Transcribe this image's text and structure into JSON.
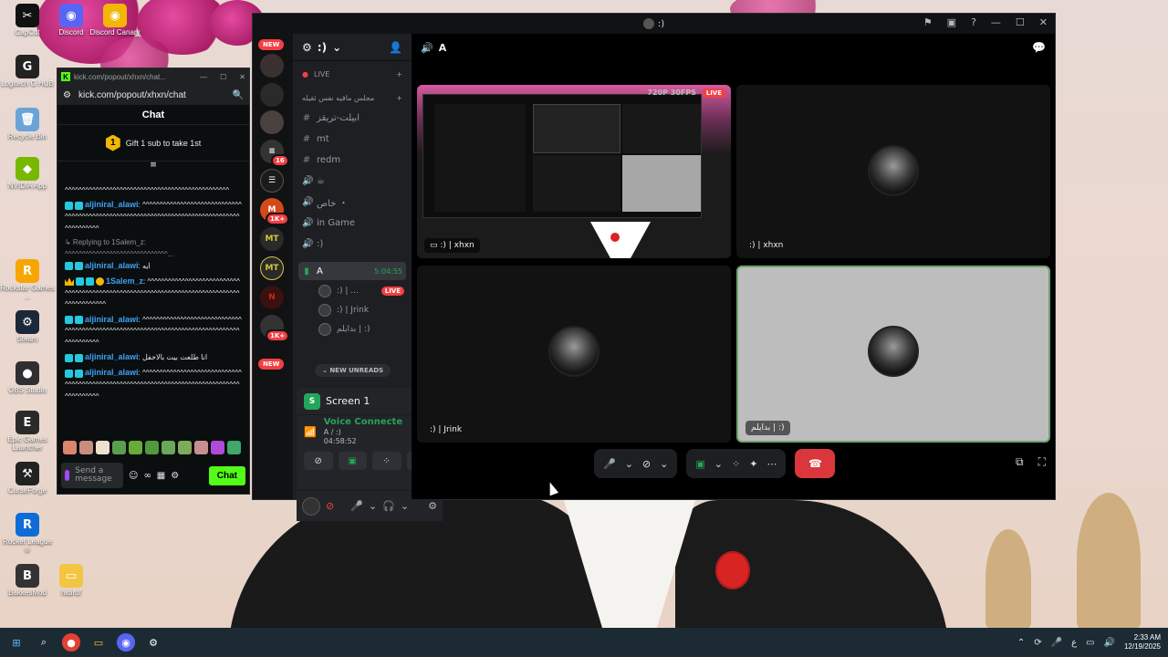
{
  "desktop": {
    "icons": [
      {
        "label": "CapCut",
        "icon": "capcut-icon",
        "color": "#111111",
        "glyph": "✂"
      },
      {
        "label": "Discord",
        "icon": "discord-icon",
        "color": "#5865f2",
        "glyph": "◉"
      },
      {
        "label": "Discord Canary",
        "icon": "discord-canary-icon",
        "color": "#f2b705",
        "glyph": "◉"
      },
      {
        "label": "Logitech G HUB",
        "icon": "logitech-ghub-icon",
        "color": "#222222",
        "glyph": "G"
      },
      {
        "label": "Recycle Bin",
        "icon": "recycle-bin-icon",
        "color": "#6aa3d8",
        "glyph": "🗑"
      },
      {
        "label": "NVIDIA App",
        "icon": "nvidia-icon",
        "color": "#76b900",
        "glyph": "◆"
      },
      {
        "label": "Rockstar Games ...",
        "icon": "rockstar-icon",
        "color": "#f7a600",
        "glyph": "R"
      },
      {
        "label": "Steam",
        "icon": "steam-icon",
        "color": "#1b2838",
        "glyph": "⚙"
      },
      {
        "label": "OBS Studio",
        "icon": "obs-icon",
        "color": "#302e31",
        "glyph": "●"
      },
      {
        "label": "Epic Games Launcher",
        "icon": "epic-games-icon",
        "color": "#2a2a2a",
        "glyph": "E"
      },
      {
        "label": "CurseForge",
        "icon": "curseforge-icon",
        "color": "#222222",
        "glyph": "⚒"
      },
      {
        "label": "Rocket League ®",
        "icon": "rocket-league-icon",
        "color": "#0f6cd6",
        "glyph": "R"
      },
      {
        "label": "BakkesMod",
        "icon": "bakkesmod-icon",
        "color": "#333333",
        "glyph": "B"
      },
      {
        "label": "hidirdf",
        "icon": "folder-icon",
        "color": "#f4c542",
        "glyph": "▭"
      }
    ]
  },
  "kick": {
    "tab_title": "kick.com/popout/xhxn/chat...",
    "url": "kick.com/popout/xhxn/chat",
    "chat_title": "Chat",
    "gift_count": "1",
    "gift_text": "Gift 1 sub to take 1st",
    "messages": [
      {
        "user": "",
        "text": "^^^^^^^^^^^^^^^^^^^^^^^^^^^^^^^^^^^^^^^^^^^^^^^^",
        "reply": ""
      },
      {
        "user": "aljiniral_alawi",
        "text": "^^^^^^^^^^^^^^^^^^^^^^^^^^^^^^^^^^^^^^^^^^^^^^^^^^^^^^^^^^^^^^^^^^^^^^^^^^^^^^^^^^^^^^^^^^",
        "reply": ""
      },
      {
        "user": "aljiniral_alawi",
        "text": "ايه",
        "reply": "Replying to 1Salem_z: ^^^^^^^^^^^^^^^^^^^^^^^^^^^^^^..."
      },
      {
        "user": "1Salem_z",
        "text": "^^^^^^^^^^^^^^^^^^^^^^^^^^^^^^^^^^^^^^^^^^^^^^^^^^^^^^^^^^^^^^^^^^^^^^^^^^^^^^^^^^^^^^^^^^",
        "reply": ""
      },
      {
        "user": "aljiniral_alawi",
        "text": "^^^^^^^^^^^^^^^^^^^^^^^^^^^^^^^^^^^^^^^^^^^^^^^^^^^^^^^^^^^^^^^^^^^^^^^^^^^^^^^^^^^^^^^^^^",
        "reply": ""
      },
      {
        "user": "aljiniral_alawi",
        "text": "انا طلعت بيت بالاخفل",
        "reply": ""
      },
      {
        "user": "aljiniral_alawi",
        "text": "^^^^^^^^^^^^^^^^^^^^^^^^^^^^^^^^^^^^^^^^^^^^^^^^^^^^^^^^^^^^^^^^^^^^^^^^^^^^^^^^^^^^^^^^^^",
        "reply": ""
      }
    ],
    "input_placeholder": "Send a message",
    "chat_button": "Chat"
  },
  "discord": {
    "window_title": ":)",
    "server_name": ":)",
    "new_pill": "NEW",
    "guild_badges": [
      "16",
      "1K+",
      "1K+"
    ],
    "channels": {
      "live_category": "LIVE",
      "category": "مجلس مافيه نفس ثقيله",
      "items": [
        {
          "icon": "#",
          "name": "ابيلت-تريقز"
        },
        {
          "icon": "#",
          "name": "mt"
        },
        {
          "icon": "#",
          "name": "redm"
        },
        {
          "icon": "🔊",
          "name": "☕"
        },
        {
          "icon": "🔊",
          "name": "خاص ・"
        },
        {
          "icon": "🔊",
          "name": "in Game"
        },
        {
          "icon": "🔊",
          "name": ":)"
        }
      ],
      "active": {
        "name": "A",
        "time": "5:04:55"
      },
      "voice_users": [
        {
          "name": ":) | ...",
          "live": "LIVE"
        },
        {
          "name": ":) | Jrink",
          "live": ""
        },
        {
          "name": "بدايلم | :)",
          "live": ""
        }
      ],
      "new_unreads": "NEW UNREADS"
    },
    "voice_panel": {
      "screen_label": "Screen 1",
      "screen_icon": "S",
      "connected": "Voice Connecte",
      "channel_path": "A / :)",
      "duration": "04:58:52"
    },
    "stage": {
      "channel": "A",
      "tiles": [
        {
          "name": ":) | xhxn",
          "kind": "screen",
          "live": "LIVE",
          "quality": "720P 30FPS"
        },
        {
          "name": ":) | xhxn",
          "kind": "avatar"
        },
        {
          "name": ":) | Jrink",
          "kind": "avatar"
        },
        {
          "name": "بدايلم | :)",
          "kind": "avatar-speaking"
        }
      ]
    }
  },
  "taskbar": {
    "time": "2:33 AM",
    "date": "12/19/2025",
    "lang": "ع"
  }
}
